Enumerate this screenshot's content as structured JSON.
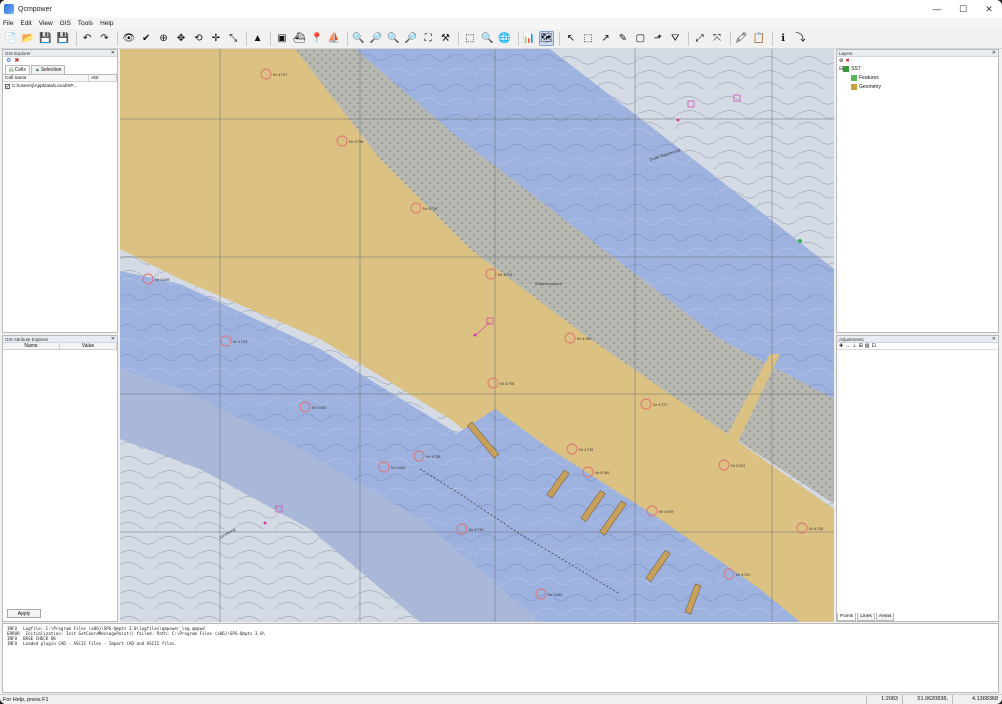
{
  "window": {
    "title": "Qcmpower",
    "controls": {
      "minimize": "—",
      "maximize": "☐",
      "close": "✕"
    }
  },
  "menu": [
    "File",
    "Edit",
    "View",
    "GIS",
    "Tools",
    "Help"
  ],
  "toolbar": [
    {
      "icon": "new-file-icon",
      "glyph": "📄"
    },
    {
      "icon": "open-folder-icon",
      "glyph": "📂"
    },
    {
      "icon": "save-icon",
      "glyph": "💾"
    },
    {
      "icon": "save-all-icon",
      "glyph": "💾"
    },
    {
      "sep": true
    },
    {
      "icon": "undo-icon",
      "glyph": "↶"
    },
    {
      "icon": "redo-icon",
      "glyph": "↷"
    },
    {
      "sep": true
    },
    {
      "icon": "view-icon",
      "glyph": "👁"
    },
    {
      "icon": "check-icon",
      "glyph": "✔"
    },
    {
      "icon": "add-point-icon",
      "glyph": "⊕"
    },
    {
      "icon": "move-point-icon",
      "glyph": "✥"
    },
    {
      "icon": "rotate-icon",
      "glyph": "⟲"
    },
    {
      "icon": "pan-arrows-icon",
      "glyph": "✛"
    },
    {
      "icon": "edit-line-icon",
      "glyph": "⤡"
    },
    {
      "sep": true
    },
    {
      "icon": "triangle-icon",
      "glyph": "▲"
    },
    {
      "sep": true
    },
    {
      "icon": "layer-red-icon",
      "glyph": "▣"
    },
    {
      "icon": "ship-icon",
      "glyph": "⛴"
    },
    {
      "icon": "marker-icon",
      "glyph": "📍"
    },
    {
      "icon": "boat-icon",
      "glyph": "⛵"
    },
    {
      "sep": true
    },
    {
      "icon": "zoom-in-red-icon",
      "glyph": "🔍"
    },
    {
      "icon": "zoom-out-red-icon",
      "glyph": "🔎"
    },
    {
      "icon": "zoom-in-icon",
      "glyph": "🔍"
    },
    {
      "icon": "zoom-out-icon",
      "glyph": "🔎"
    },
    {
      "icon": "zoom-extent-icon",
      "glyph": "⛶"
    },
    {
      "icon": "zoom-tool-icon",
      "glyph": "⚒"
    },
    {
      "sep": true
    },
    {
      "icon": "zoom-box-icon",
      "glyph": "⬚"
    },
    {
      "icon": "search-icon",
      "glyph": "🔍"
    },
    {
      "icon": "globe-icon",
      "glyph": "🌐"
    },
    {
      "sep": true
    },
    {
      "icon": "chart-icon",
      "glyph": "📊"
    },
    {
      "icon": "map-layer-icon",
      "glyph": "🗺",
      "active": true
    },
    {
      "sep": true
    },
    {
      "icon": "select-arrow-icon",
      "glyph": "↖"
    },
    {
      "icon": "select-box-icon",
      "glyph": "⬚"
    },
    {
      "icon": "select-poly-icon",
      "glyph": "↗"
    },
    {
      "icon": "pencil-icon",
      "glyph": "✎"
    },
    {
      "icon": "select-area-icon",
      "glyph": "▢"
    },
    {
      "icon": "select-feature-icon",
      "glyph": "⬏"
    },
    {
      "icon": "filter-icon",
      "glyph": "⛛"
    },
    {
      "sep": true
    },
    {
      "icon": "measure-icon",
      "glyph": "⤢"
    },
    {
      "icon": "measure-area-icon",
      "glyph": "⤧"
    },
    {
      "sep": true
    },
    {
      "icon": "highlighter-icon",
      "glyph": "🖍"
    },
    {
      "icon": "report-icon",
      "glyph": "📋"
    },
    {
      "sep": true
    },
    {
      "icon": "info-icon",
      "glyph": "ℹ"
    },
    {
      "icon": "pick-icon",
      "glyph": "⤵"
    }
  ],
  "gis_explorer": {
    "title": "GIS Explorer",
    "tabs": [
      "Cells",
      "Selection"
    ],
    "columns": [
      "Cell name",
      "Attr"
    ],
    "rows": [
      {
        "checked": true,
        "name": "C:\\Users\\j\\AppData\\Local\\SP..."
      }
    ]
  },
  "attributes": {
    "title": "GIS Attribute Explorer",
    "columns": [
      "Name",
      "Value"
    ],
    "apply_label": "Apply"
  },
  "layers": {
    "title": "Layers",
    "root": "SS7",
    "children": [
      "Features",
      "Geometry"
    ]
  },
  "adjustments": {
    "title": "Adjustments",
    "tabs": [
      "Points",
      "Lines",
      "Areas"
    ]
  },
  "log": [
    {
      "type": "INFO",
      "text": "Logfile: C:\\Program Files (x86)\\SPS-Qmpts 3.0\\logfiles\\qmpower_log.qmpwd"
    },
    {
      "type": "ERROR",
      "text": "Initialization: Init GetCoordMessagePoint() failed. Path: C:\\Program Files (x86)\\SPS-Qmpts 3.0\\"
    },
    {
      "type": "INFO",
      "text": "BASE CHECK OK"
    },
    {
      "type": "INFO",
      "text": "Loaded plugin CAD - ASCII Files - Import CAD and ASCII files."
    }
  ],
  "status": {
    "help": "For Help, press F1",
    "scale": "1:2083",
    "lat": "51.9620838,",
    "lon": "4.1368368"
  },
  "map": {
    "colors": {
      "land": "#dcc282",
      "deep_water": "#8fa8dd",
      "shallow_water": "#b8c7e6",
      "hatched_area": "#b4b6b0",
      "terrain": "#d2dae4",
      "contour": "#7f8ba0",
      "buoy": "#e57777",
      "magenta": "#d33bb0"
    },
    "depth_labels": [
      "Nr 4737",
      "Nr 4736",
      "Nr 4725",
      "Nr 5449",
      "Nr 4724",
      "Nr 4723",
      "Nr 4766",
      "Nr 4756",
      "Nr 5455",
      "Nr 4727",
      "Nr 5435",
      "Nr 4736",
      "Nr 4735",
      "Nr 5422",
      "Nr 4739",
      "Nr 5439",
      "Nr 4734",
      "Nr 4751",
      "Nr 5443",
      "Nr 4760"
    ],
    "place_labels": [
      "Oude Maasmond",
      "Slibbersoppen",
      "Landtong"
    ]
  }
}
